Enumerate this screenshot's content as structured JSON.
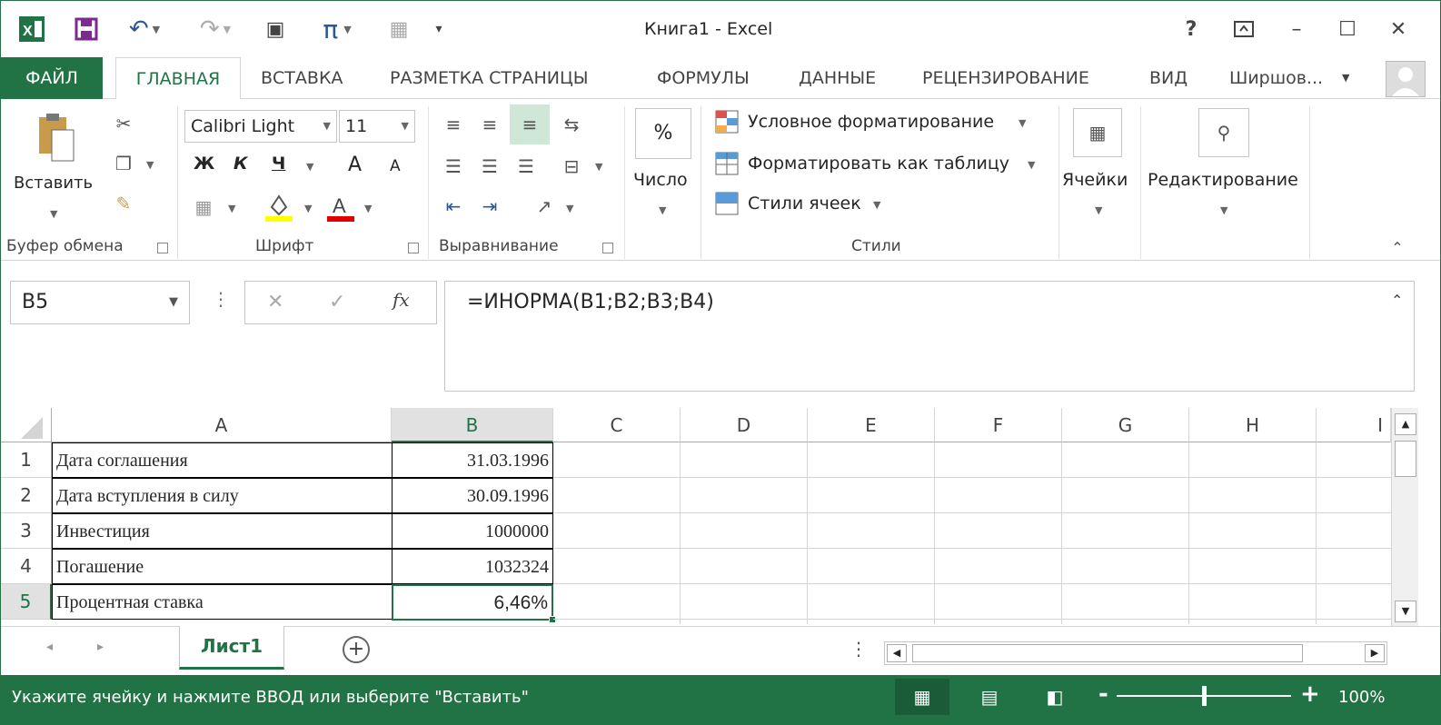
{
  "window": {
    "title": "Книга1 - Excel",
    "help": "?",
    "minimize": "–",
    "maximize": "☐",
    "close": "✕"
  },
  "tabs": [
    {
      "label": "ФАЙЛ"
    },
    {
      "label": "ГЛАВНАЯ"
    },
    {
      "label": "ВСТАВКА"
    },
    {
      "label": "РАЗМЕТКА СТРАНИЦЫ"
    },
    {
      "label": "ФОРМУЛЫ"
    },
    {
      "label": "ДАННЫЕ"
    },
    {
      "label": "РЕЦЕНЗИРОВАНИЕ"
    },
    {
      "label": "ВИД"
    }
  ],
  "user": "Ширшов...",
  "ribbon": {
    "paste_label": "Вставить",
    "clipboard_label": "Буфер обмена",
    "font_name": "Calibri Light",
    "font_size": "11",
    "bold": "Ж",
    "italic": "К",
    "underline": "Ч",
    "grow": "A",
    "shrink": "A",
    "font_label": "Шрифт",
    "align_label": "Выравнивание",
    "percent": "%",
    "number_label": "Число",
    "cond_format": "Условное форматирование",
    "format_table": "Форматировать как таблицу",
    "cell_styles": "Стили ячеек",
    "styles_label": "Стили",
    "cells_label": "Ячейки",
    "editing_label": "Редактирование"
  },
  "formula_bar": {
    "name_box": "B5",
    "cancel": "✕",
    "enter": "✓",
    "fx": "fx",
    "formula": "=ИНОРМА(B1;B2;B3;B4)"
  },
  "columns": [
    "A",
    "B",
    "C",
    "D",
    "E",
    "F",
    "G",
    "H",
    "I"
  ],
  "rows": [
    {
      "num": "1",
      "a": "Дата соглашения",
      "b": "31.03.1996"
    },
    {
      "num": "2",
      "a": "Дата вступления в силу",
      "b": "30.09.1996"
    },
    {
      "num": "3",
      "a": "Инвестиция",
      "b": "1000000"
    },
    {
      "num": "4",
      "a": "Погашение",
      "b": "1032324"
    },
    {
      "num": "5",
      "a": "Процентная ставка",
      "b": "6,46%"
    }
  ],
  "sheet": {
    "tab": "Лист1",
    "add": "+"
  },
  "status": {
    "message": "Укажите ячейку и нажмите ВВОД или выберите \"Вставить\"",
    "zoom_minus": "-",
    "zoom_plus": "+",
    "zoom": "100%",
    "zoom_level": 0.5
  },
  "colors": {
    "accent": "#217346"
  }
}
